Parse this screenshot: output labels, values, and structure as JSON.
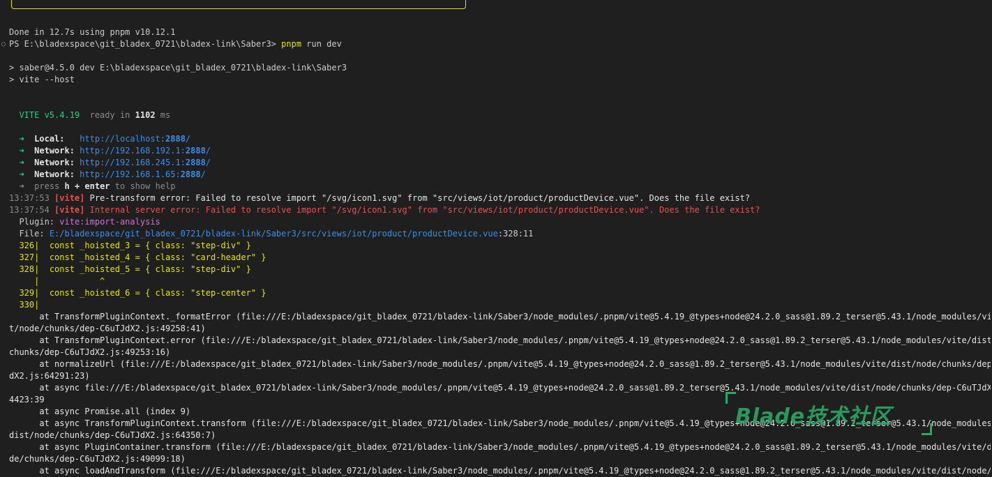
{
  "terminal": {
    "done": "Done in 12.7s using pnpm v10.12.1",
    "prompt": "PS E:\\bladexspace\\git_bladex_0721\\bladex-link\\Saber3>",
    "command_name": "pnpm",
    "command_args": "run dev",
    "script_line": "> saber@4.5.0 dev E:\\bladexspace\\git_bladex_0721\\bladex-link\\Saber3",
    "vite_line": "> vite --host",
    "vite_name": "VITE v5.4.19",
    "ready_in": "ready in",
    "ready_ms": "1102",
    "ready_unit": "ms",
    "urls": [
      {
        "label": "Local:",
        "pad": "   ",
        "prefix": "http://localhost:",
        "port": "2888",
        "suffix": "/"
      },
      {
        "label": "Network:",
        "pad": " ",
        "prefix": "http://192.168.192.1:",
        "port": "2888",
        "suffix": "/"
      },
      {
        "label": "Network:",
        "pad": " ",
        "prefix": "http://192.168.245.1:",
        "port": "2888",
        "suffix": "/"
      },
      {
        "label": "Network:",
        "pad": " ",
        "prefix": "http://192.168.1.65:",
        "port": "2888",
        "suffix": "/"
      }
    ],
    "help_press": "press",
    "help_keys": "h + enter",
    "help_rest": "to show help",
    "errors": [
      {
        "time": "13:37:53",
        "tag": "[vite]",
        "msg": "Pre-transform error: Failed to resolve import \"/svg/icon1.svg\" from \"src/views/iot/product/productDevice.vue\". Does the file exist?"
      },
      {
        "time": "13:37:54",
        "tag": "[vite]",
        "msg": "Internal server error: Failed to resolve import \"/svg/icon1.svg\" from \"src/views/iot/product/productDevice.vue\". Does the file exist?"
      }
    ],
    "plugin_label": "Plugin:",
    "plugin_value": "vite:import-analysis",
    "file_label": "File:",
    "file_path": "E:/bladexspace/git_bladex_0721/bladex-link/Saber3/src/views/iot/product/productDevice.vue",
    "file_pos": ":328:11",
    "code": [
      {
        "num": "326|",
        "text": "const _hoisted_3 = { class: \"step-div\" }"
      },
      {
        "num": "327|",
        "text": "const _hoisted_4 = { class: \"card-header\" }"
      },
      {
        "num": "328|",
        "text": "const _hoisted_5 = { class: \"step-div\" }"
      },
      {
        "num": "   |",
        "text": "          ^"
      },
      {
        "num": "329|",
        "text": "const _hoisted_6 = { class: \"step-center\" }"
      },
      {
        "num": "330|",
        "text": ""
      }
    ],
    "stack": [
      "      at TransformPluginContext._formatError (file:///E:/bladexspace/git_bladex_0721/bladex-link/Saber3/node_modules/.pnpm/vite@5.4.19_@types+node@24.2.0_sass@1.89.2_terser@5.43.1/node_modules/vite/dis",
      "t/node/chunks/dep-C6uTJdX2.js:49258:41)",
      "      at TransformPluginContext.error (file:///E:/bladexspace/git_bladex_0721/bladex-link/Saber3/node_modules/.pnpm/vite@5.4.19_@types+node@24.2.0_sass@1.89.2_terser@5.43.1/node_modules/vite/dist/node/",
      "chunks/dep-C6uTJdX2.js:49253:16)",
      "      at normalizeUrl (file:///E:/bladexspace/git_bladex_0721/bladex-link/Saber3/node_modules/.pnpm/vite@5.4.19_@types+node@24.2.0_sass@1.89.2_terser@5.43.1/node_modules/vite/dist/node/chunks/dep-C6uTJ",
      "dX2.js:64291:23)",
      "      at async file:///E:/bladexspace/git_bladex_0721/bladex-link/Saber3/node_modules/.pnpm/vite@5.4.19_@types+node@24.2.0_sass@1.89.2_terser@5.43.1/node_modules/vite/dist/node/chunks/dep-C6uTJdX2.js:6",
      "4423:39",
      "      at async Promise.all (index 9)",
      "      at async TransformPluginContext.transform (file:///E:/bladexspace/git_bladex_0721/bladex-link/Saber3/node_modules/.pnpm/vite@5.4.19_@types+node@24.2.0_sass@1.89.2_terser@5.43.1/node_modules/vite/",
      "dist/node/chunks/dep-C6uTJdX2.js:64350:7)",
      "      at async PluginContainer.transform (file:///E:/bladexspace/git_bladex_0721/bladex-link/Saber3/node_modules/.pnpm/vite@5.4.19_@types+node@24.2.0_sass@1.89.2_terser@5.43.1/node_modules/vite/dist/no",
      "de/chunks/dep-C6uTJdX2.js:49099:18)",
      "      at async loadAndTransform (file:///E:/bladexspace/git_bladex_0721/bladex-link/Saber3/node_modules/.pnpm/vite@5.4.19_@types+node@24.2.0_sass@1.89.2_terser@5.43.1/node_modules/vite/dist/node/chunks"
    ]
  },
  "watermark": {
    "text": "Blade技术社区"
  },
  "arrow_glyph": "➜"
}
